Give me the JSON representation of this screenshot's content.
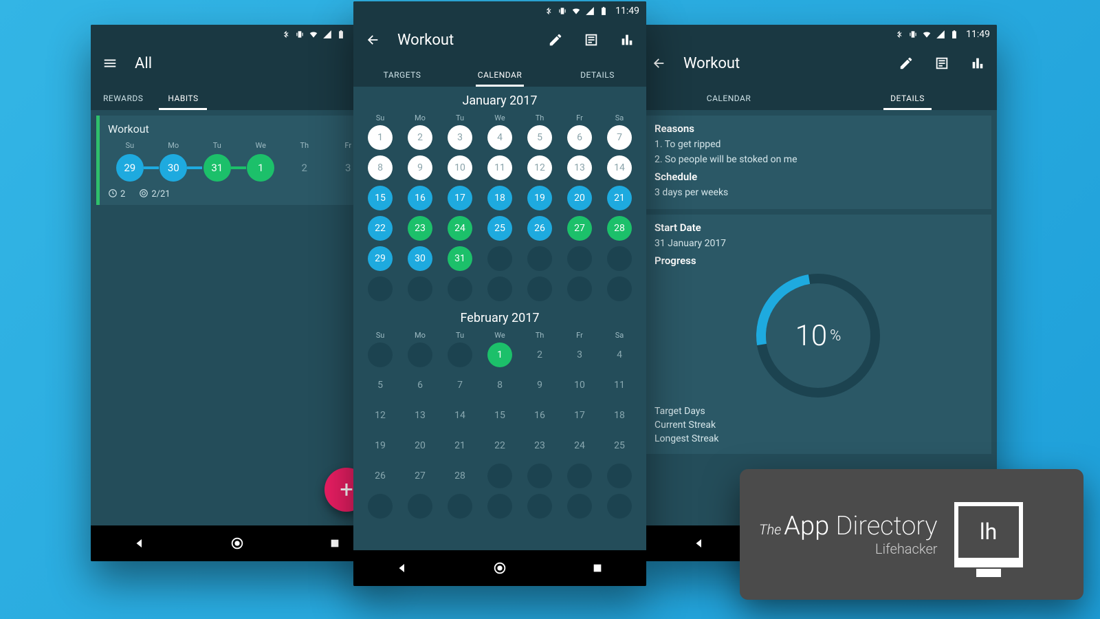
{
  "status": {
    "time": "11:49"
  },
  "phone1": {
    "title": "All",
    "tabs": {
      "rewards": "REWARDS",
      "habits": "HABITS"
    },
    "habit": {
      "name": "Workout",
      "dows": [
        "Su",
        "Mo",
        "Tu",
        "We",
        "Th",
        "Fr"
      ],
      "days": [
        "29",
        "30",
        "31",
        "1",
        "2",
        "3"
      ],
      "footer": {
        "streak": "2",
        "ratio": "2/21"
      }
    }
  },
  "phone2": {
    "title": "Workout",
    "tabs": {
      "targets": "TARGETS",
      "calendar": "CALENDAR",
      "details": "DETAILS"
    },
    "dows": [
      "Su",
      "Mo",
      "Tu",
      "We",
      "Th",
      "Fr",
      "Sa"
    ],
    "month1": "January 2017",
    "month2": "February 2017"
  },
  "phone3": {
    "title": "Workout",
    "tabs": {
      "calendar": "CALENDAR",
      "details": "DETAILS"
    },
    "reasons": {
      "h": "Reasons",
      "r1": "1. To get ripped",
      "r2": "2. So people will be stoked on me"
    },
    "schedule": {
      "h": "Schedule",
      "v": "3 days per weeks"
    },
    "start": {
      "h": "Start Date",
      "v": "31 January 2017"
    },
    "progress": {
      "h": "Progress",
      "pct": "10"
    },
    "stats": {
      "target": "Target Days",
      "current": "Current Streak",
      "longest": "Longest Streak"
    }
  },
  "badge": {
    "the": "The",
    "app": "App",
    "dir": "Directory",
    "sub": "Lifehacker",
    "lh": "lh"
  }
}
